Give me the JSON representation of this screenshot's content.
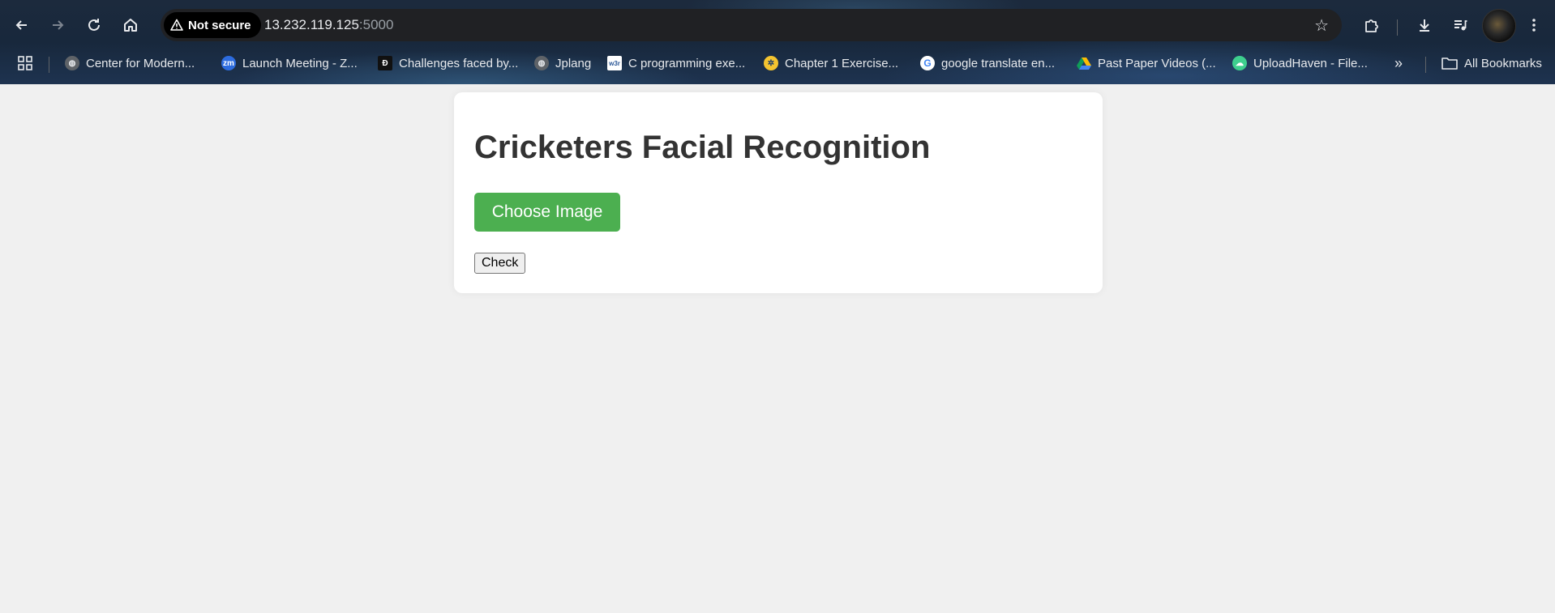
{
  "browser": {
    "security_label": "Not secure",
    "url_host": "13.232.119.125",
    "url_port": ":5000",
    "icons": {
      "back": "back-arrow-icon",
      "forward": "forward-arrow-icon",
      "reload": "reload-icon",
      "home": "home-icon",
      "warning": "warning-triangle-icon",
      "bookmark_star": "star-icon",
      "extensions": "puzzle-icon",
      "downloads": "download-icon",
      "media": "media-queue-icon",
      "menu": "kebab-menu-icon"
    }
  },
  "bookmarks": {
    "items": [
      {
        "label": "Center for Modern...",
        "icon": "globe-icon"
      },
      {
        "label": "Launch Meeting - Z...",
        "icon": "zoom-icon"
      },
      {
        "label": "Challenges faced by...",
        "icon": "d-logo-icon"
      },
      {
        "label": "Jplang",
        "icon": "globe-icon"
      },
      {
        "label": "C programming exe...",
        "icon": "w3r-icon"
      },
      {
        "label": "Chapter 1 Exercise...",
        "icon": "wheel-icon"
      },
      {
        "label": "google translate en...",
        "icon": "google-icon"
      },
      {
        "label": "Past Paper Videos (...",
        "icon": "drive-icon"
      },
      {
        "label": "UploadHaven - File...",
        "icon": "cloud-icon"
      }
    ],
    "all_bookmarks_label": "All Bookmarks",
    "zm_text": "zm",
    "w3r_text": "w3r",
    "g_text": "G"
  },
  "page": {
    "title": "Cricketers Facial Recognition",
    "choose_button": "Choose Image",
    "check_button": "Check"
  },
  "colors": {
    "primary_button": "#4caf50",
    "background": "#f0f0f0",
    "card": "#ffffff",
    "title_text": "#333333"
  }
}
